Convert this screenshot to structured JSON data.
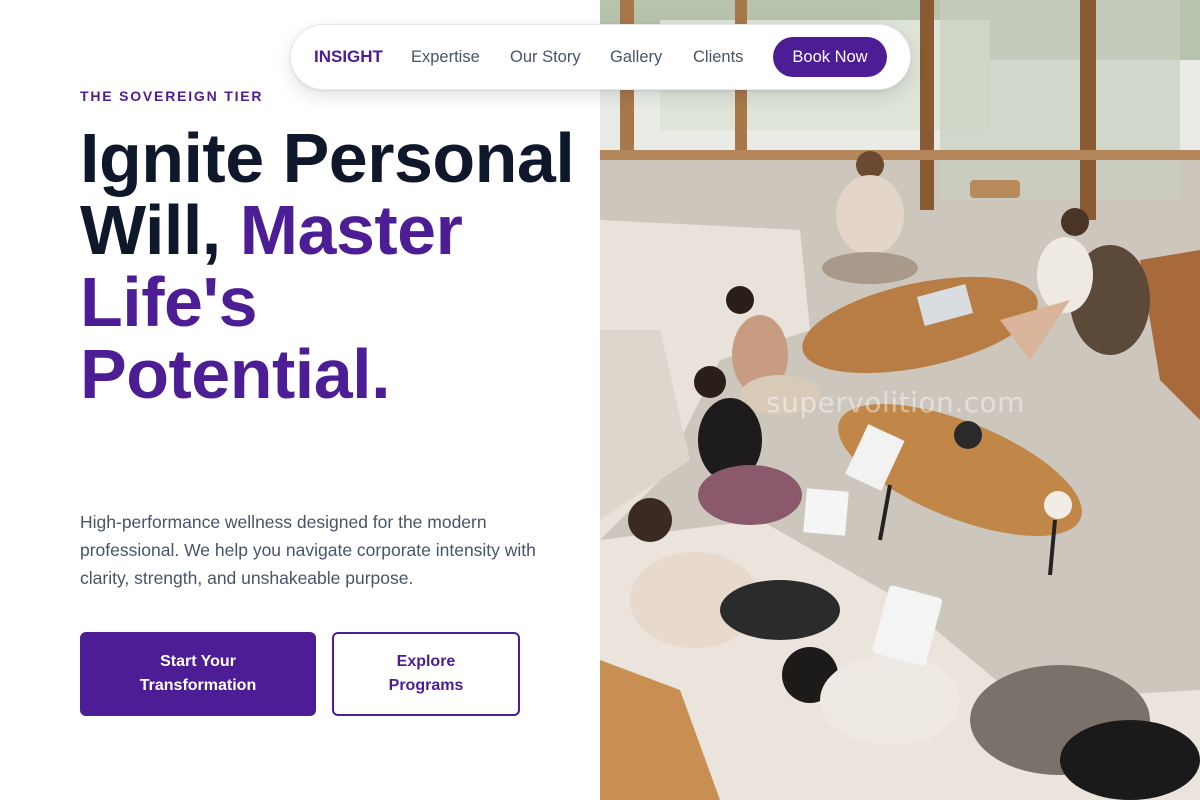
{
  "nav": {
    "logo": "INSIGHT",
    "links": [
      "Expertise",
      "Our Story",
      "Gallery",
      "Clients"
    ],
    "cta": "Book Now"
  },
  "hero": {
    "eyebrow": "THE SOVEREIGN TIER",
    "headline_dark": "Ignite Personal Will, ",
    "headline_accent": "Master Life's Potential.",
    "subcopy": "High-performance wellness designed for the modern professional. We help you navigate corporate intensity with clarity, strength, and unshakeable purpose.",
    "primary_button_line1": "Start Your",
    "primary_button_line2": "Transformation",
    "secondary_button_line1": "Explore",
    "secondary_button_line2": "Programs"
  },
  "photo": {
    "watermark": "supervolition.com",
    "icon": "group-meditation-photo"
  },
  "colors": {
    "brand": "#4c1d95",
    "heading": "#0f172a",
    "body": "#475569",
    "background": "#ffffff"
  }
}
